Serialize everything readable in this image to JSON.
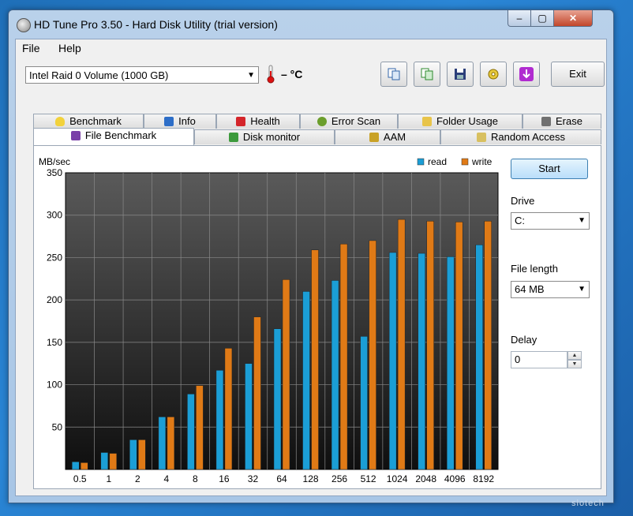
{
  "window": {
    "title": "HD Tune Pro 3.50 - Hard Disk Utility (trial version)",
    "controls": {
      "minimize": "‒",
      "maximize": "▢",
      "close": "✕"
    }
  },
  "menu": {
    "file": "File",
    "help": "Help"
  },
  "toolbar": {
    "drive": "Intel   Raid 0 Volume (1000 GB)",
    "temperature": "– °C",
    "exit_label": "Exit"
  },
  "tabs": {
    "row1": [
      "Benchmark",
      "Info",
      "Health",
      "Error Scan",
      "Folder Usage",
      "Erase"
    ],
    "row2": [
      "File Benchmark",
      "Disk monitor",
      "AAM",
      "Random Access"
    ]
  },
  "side": {
    "start_label": "Start",
    "drive_label": "Drive",
    "drive_value": "C:",
    "file_length_label": "File length",
    "file_length_value": "64 MB",
    "delay_label": "Delay",
    "delay_value": "0"
  },
  "colors": {
    "read": "#1b9ed6",
    "write": "#e07a16",
    "plot_bg_top": "#5a5a5a",
    "plot_bg_bottom": "#0f0f0f"
  },
  "chart_data": {
    "type": "bar",
    "ylabel": "MB/sec",
    "ylim": [
      0,
      350
    ],
    "yticks": [
      50,
      100,
      150,
      200,
      250,
      300,
      350
    ],
    "grid": true,
    "legend_position": "top-right",
    "categories": [
      "0.5",
      "1",
      "2",
      "4",
      "8",
      "16",
      "32",
      "64",
      "128",
      "256",
      "512",
      "1024",
      "2048",
      "4096",
      "8192"
    ],
    "series": [
      {
        "name": "read",
        "values": [
          9,
          20,
          35,
          62,
          89,
          117,
          125,
          166,
          210,
          223,
          157,
          256,
          255,
          251,
          265
        ]
      },
      {
        "name": "write",
        "values": [
          8,
          19,
          35,
          62,
          99,
          143,
          180,
          224,
          259,
          266,
          270,
          295,
          293,
          292,
          293
        ]
      }
    ]
  },
  "watermark": "slotech"
}
